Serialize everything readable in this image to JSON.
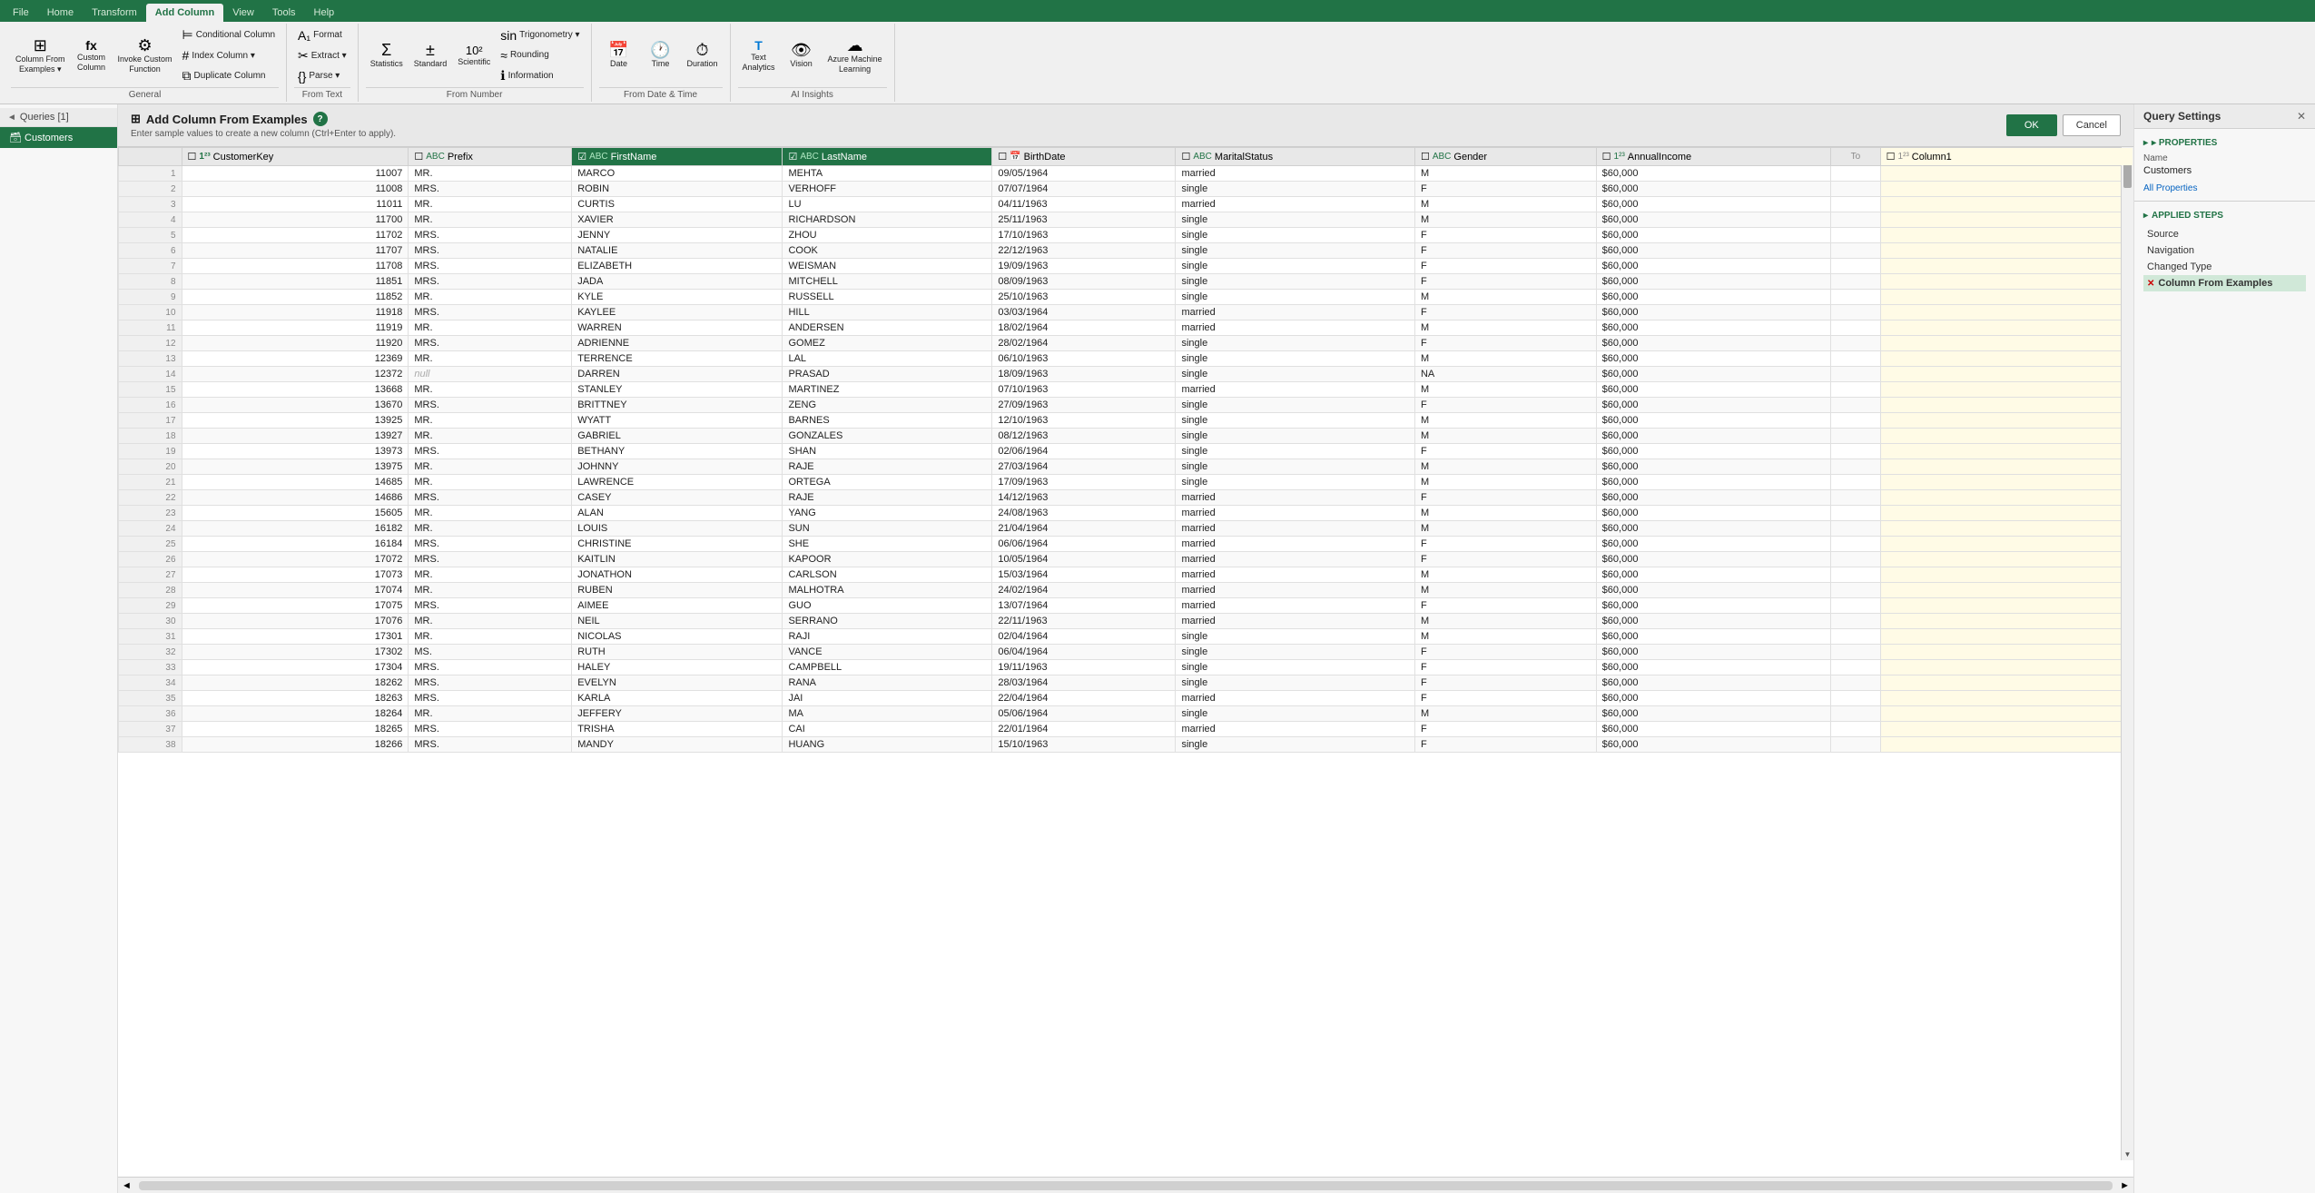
{
  "ribbon": {
    "tabs": [
      "File",
      "Home",
      "Transform",
      "Add Column",
      "View",
      "Tools",
      "Help"
    ],
    "active_tab": "Add Column",
    "groups": [
      {
        "name": "General",
        "items": [
          {
            "id": "column-from-examples",
            "icon": "⊞",
            "label": "Column From\nExamples ▾"
          },
          {
            "id": "custom-column",
            "icon": "fx",
            "label": "Custom\nColumn"
          },
          {
            "id": "invoke-custom",
            "icon": "⚙",
            "label": "Invoke Custom\nFunction"
          },
          {
            "id": "conditional-column",
            "icon": "⟦⟧",
            "label": "Conditional Column"
          },
          {
            "id": "index-column",
            "icon": "#",
            "label": "Index Column ▾"
          },
          {
            "id": "duplicate-column",
            "icon": "⧉",
            "label": "Duplicate Column"
          }
        ]
      },
      {
        "name": "From Text",
        "items": [
          {
            "id": "format",
            "icon": "A₁",
            "label": "Format"
          },
          {
            "id": "extract",
            "icon": "✂",
            "label": "Extract ▾"
          },
          {
            "id": "parse",
            "icon": "{}",
            "label": "Parse ▾"
          }
        ]
      },
      {
        "name": "From Number",
        "items": [
          {
            "id": "statistics",
            "icon": "Σ",
            "label": "Statistics"
          },
          {
            "id": "standard",
            "icon": "±",
            "label": "Standard"
          },
          {
            "id": "scientific",
            "icon": "10²",
            "label": "Scientific"
          },
          {
            "id": "trigonometry",
            "icon": "sin",
            "label": "Trigonometry ▾"
          },
          {
            "id": "rounding",
            "icon": "≈",
            "label": "Rounding"
          },
          {
            "id": "information",
            "icon": "ℹ",
            "label": "Information"
          }
        ]
      },
      {
        "name": "From Date & Time",
        "items": [
          {
            "id": "date",
            "icon": "📅",
            "label": "Date"
          },
          {
            "id": "time",
            "icon": "🕐",
            "label": "Time"
          },
          {
            "id": "duration",
            "icon": "⏱",
            "label": "Duration"
          },
          {
            "id": "text-analytics",
            "icon": "T",
            "label": "Text\nAnalytics"
          },
          {
            "id": "vision",
            "icon": "👁",
            "label": "Vision"
          },
          {
            "id": "azure-ml",
            "icon": "☁",
            "label": "Azure Machine\nLearning"
          }
        ]
      }
    ]
  },
  "sidebar": {
    "header": "Queries [1]",
    "items": [
      {
        "label": "Customers",
        "active": true
      }
    ]
  },
  "dialog": {
    "title": "Add Column From Examples",
    "subtitle": "Enter sample values to create a new column (Ctrl+Enter to apply).",
    "btn_ok": "OK",
    "btn_cancel": "Cancel"
  },
  "table": {
    "columns": [
      {
        "id": "customerkey",
        "label": "CustomerKey",
        "type": "123",
        "checked": false
      },
      {
        "id": "prefix",
        "label": "Prefix",
        "type": "ABC",
        "checked": false
      },
      {
        "id": "firstname",
        "label": "FirstName",
        "type": "ABC",
        "checked": true,
        "highlight": true
      },
      {
        "id": "lastname",
        "label": "LastName",
        "type": "ABC",
        "checked": true,
        "highlight": true
      },
      {
        "id": "birthdate",
        "label": "BirthDate",
        "type": "cal",
        "checked": false
      },
      {
        "id": "maritalstatus",
        "label": "MaritalStatus",
        "type": "ABC",
        "checked": false
      },
      {
        "id": "gender",
        "label": "Gender",
        "type": "ABC",
        "checked": false
      },
      {
        "id": "annualincome",
        "label": "AnnualIncome",
        "type": "123",
        "checked": false
      },
      {
        "id": "column1",
        "label": "Column1",
        "type": "123",
        "checked": false,
        "last": true
      }
    ],
    "rows": [
      {
        "num": 1,
        "customerkey": "11007",
        "prefix": "MR.",
        "firstname": "MARCO",
        "lastname": "MEHTA",
        "birthdate": "09/05/1964",
        "maritalstatus": "married",
        "gender": "M",
        "annualincome": "$60,000",
        "column1": ""
      },
      {
        "num": 2,
        "customerkey": "11008",
        "prefix": "MRS.",
        "firstname": "ROBIN",
        "lastname": "VERHOFF",
        "birthdate": "07/07/1964",
        "maritalstatus": "single",
        "gender": "F",
        "annualincome": "$60,000",
        "column1": ""
      },
      {
        "num": 3,
        "customerkey": "11011",
        "prefix": "MR.",
        "firstname": "CURTIS",
        "lastname": "LU",
        "birthdate": "04/11/1963",
        "maritalstatus": "married",
        "gender": "M",
        "annualincome": "$60,000",
        "column1": ""
      },
      {
        "num": 4,
        "customerkey": "11700",
        "prefix": "MR.",
        "firstname": "XAVIER",
        "lastname": "RICHARDSON",
        "birthdate": "25/11/1963",
        "maritalstatus": "single",
        "gender": "M",
        "annualincome": "$60,000",
        "column1": ""
      },
      {
        "num": 5,
        "customerkey": "11702",
        "prefix": "MRS.",
        "firstname": "JENNY",
        "lastname": "ZHOU",
        "birthdate": "17/10/1963",
        "maritalstatus": "single",
        "gender": "F",
        "annualincome": "$60,000",
        "column1": ""
      },
      {
        "num": 6,
        "customerkey": "11707",
        "prefix": "MRS.",
        "firstname": "NATALIE",
        "lastname": "COOK",
        "birthdate": "22/12/1963",
        "maritalstatus": "single",
        "gender": "F",
        "annualincome": "$60,000",
        "column1": ""
      },
      {
        "num": 7,
        "customerkey": "11708",
        "prefix": "MRS.",
        "firstname": "ELIZABETH",
        "lastname": "WEISMAN",
        "birthdate": "19/09/1963",
        "maritalstatus": "single",
        "gender": "F",
        "annualincome": "$60,000",
        "column1": ""
      },
      {
        "num": 8,
        "customerkey": "11851",
        "prefix": "MRS.",
        "firstname": "JADA",
        "lastname": "MITCHELL",
        "birthdate": "08/09/1963",
        "maritalstatus": "single",
        "gender": "F",
        "annualincome": "$60,000",
        "column1": ""
      },
      {
        "num": 9,
        "customerkey": "11852",
        "prefix": "MR.",
        "firstname": "KYLE",
        "lastname": "RUSSELL",
        "birthdate": "25/10/1963",
        "maritalstatus": "single",
        "gender": "M",
        "annualincome": "$60,000",
        "column1": ""
      },
      {
        "num": 10,
        "customerkey": "11918",
        "prefix": "MRS.",
        "firstname": "KAYLEE",
        "lastname": "HILL",
        "birthdate": "03/03/1964",
        "maritalstatus": "married",
        "gender": "F",
        "annualincome": "$60,000",
        "column1": ""
      },
      {
        "num": 11,
        "customerkey": "11919",
        "prefix": "MR.",
        "firstname": "WARREN",
        "lastname": "ANDERSEN",
        "birthdate": "18/02/1964",
        "maritalstatus": "married",
        "gender": "M",
        "annualincome": "$60,000",
        "column1": ""
      },
      {
        "num": 12,
        "customerkey": "11920",
        "prefix": "MRS.",
        "firstname": "ADRIENNE",
        "lastname": "GOMEZ",
        "birthdate": "28/02/1964",
        "maritalstatus": "single",
        "gender": "F",
        "annualincome": "$60,000",
        "column1": ""
      },
      {
        "num": 13,
        "customerkey": "12369",
        "prefix": "MR.",
        "firstname": "TERRENCE",
        "lastname": "LAL",
        "birthdate": "06/10/1963",
        "maritalstatus": "single",
        "gender": "M",
        "annualincome": "$60,000",
        "column1": ""
      },
      {
        "num": 14,
        "customerkey": "12372",
        "prefix": "null",
        "firstname": "DARREN",
        "lastname": "PRASAD",
        "birthdate": "18/09/1963",
        "maritalstatus": "single",
        "gender": "NA",
        "annualincome": "$60,000",
        "column1": ""
      },
      {
        "num": 15,
        "customerkey": "13668",
        "prefix": "MR.",
        "firstname": "STANLEY",
        "lastname": "MARTINEZ",
        "birthdate": "07/10/1963",
        "maritalstatus": "married",
        "gender": "M",
        "annualincome": "$60,000",
        "column1": ""
      },
      {
        "num": 16,
        "customerkey": "13670",
        "prefix": "MRS.",
        "firstname": "BRITTNEY",
        "lastname": "ZENG",
        "birthdate": "27/09/1963",
        "maritalstatus": "single",
        "gender": "F",
        "annualincome": "$60,000",
        "column1": ""
      },
      {
        "num": 17,
        "customerkey": "13925",
        "prefix": "MR.",
        "firstname": "WYATT",
        "lastname": "BARNES",
        "birthdate": "12/10/1963",
        "maritalstatus": "single",
        "gender": "M",
        "annualincome": "$60,000",
        "column1": ""
      },
      {
        "num": 18,
        "customerkey": "13927",
        "prefix": "MR.",
        "firstname": "GABRIEL",
        "lastname": "GONZALES",
        "birthdate": "08/12/1963",
        "maritalstatus": "single",
        "gender": "M",
        "annualincome": "$60,000",
        "column1": ""
      },
      {
        "num": 19,
        "customerkey": "13973",
        "prefix": "MRS.",
        "firstname": "BETHANY",
        "lastname": "SHAN",
        "birthdate": "02/06/1964",
        "maritalstatus": "single",
        "gender": "F",
        "annualincome": "$60,000",
        "column1": ""
      },
      {
        "num": 20,
        "customerkey": "13975",
        "prefix": "MR.",
        "firstname": "JOHNNY",
        "lastname": "RAJE",
        "birthdate": "27/03/1964",
        "maritalstatus": "single",
        "gender": "M",
        "annualincome": "$60,000",
        "column1": ""
      },
      {
        "num": 21,
        "customerkey": "14685",
        "prefix": "MR.",
        "firstname": "LAWRENCE",
        "lastname": "ORTEGA",
        "birthdate": "17/09/1963",
        "maritalstatus": "single",
        "gender": "M",
        "annualincome": "$60,000",
        "column1": ""
      },
      {
        "num": 22,
        "customerkey": "14686",
        "prefix": "MRS.",
        "firstname": "CASEY",
        "lastname": "RAJE",
        "birthdate": "14/12/1963",
        "maritalstatus": "married",
        "gender": "F",
        "annualincome": "$60,000",
        "column1": ""
      },
      {
        "num": 23,
        "customerkey": "15605",
        "prefix": "MR.",
        "firstname": "ALAN",
        "lastname": "YANG",
        "birthdate": "24/08/1963",
        "maritalstatus": "married",
        "gender": "M",
        "annualincome": "$60,000",
        "column1": ""
      },
      {
        "num": 24,
        "customerkey": "16182",
        "prefix": "MR.",
        "firstname": "LOUIS",
        "lastname": "SUN",
        "birthdate": "21/04/1964",
        "maritalstatus": "married",
        "gender": "M",
        "annualincome": "$60,000",
        "column1": ""
      },
      {
        "num": 25,
        "customerkey": "16184",
        "prefix": "MRS.",
        "firstname": "CHRISTINE",
        "lastname": "SHE",
        "birthdate": "06/06/1964",
        "maritalstatus": "married",
        "gender": "F",
        "annualincome": "$60,000",
        "column1": ""
      },
      {
        "num": 26,
        "customerkey": "17072",
        "prefix": "MRS.",
        "firstname": "KAITLIN",
        "lastname": "KAPOOR",
        "birthdate": "10/05/1964",
        "maritalstatus": "married",
        "gender": "F",
        "annualincome": "$60,000",
        "column1": ""
      },
      {
        "num": 27,
        "customerkey": "17073",
        "prefix": "MR.",
        "firstname": "JONATHON",
        "lastname": "CARLSON",
        "birthdate": "15/03/1964",
        "maritalstatus": "married",
        "gender": "M",
        "annualincome": "$60,000",
        "column1": ""
      },
      {
        "num": 28,
        "customerkey": "17074",
        "prefix": "MR.",
        "firstname": "RUBEN",
        "lastname": "MALHOTRA",
        "birthdate": "24/02/1964",
        "maritalstatus": "married",
        "gender": "M",
        "annualincome": "$60,000",
        "column1": ""
      },
      {
        "num": 29,
        "customerkey": "17075",
        "prefix": "MRS.",
        "firstname": "AIMEE",
        "lastname": "GUO",
        "birthdate": "13/07/1964",
        "maritalstatus": "married",
        "gender": "F",
        "annualincome": "$60,000",
        "column1": ""
      },
      {
        "num": 30,
        "customerkey": "17076",
        "prefix": "MR.",
        "firstname": "NEIL",
        "lastname": "SERRANO",
        "birthdate": "22/11/1963",
        "maritalstatus": "married",
        "gender": "M",
        "annualincome": "$60,000",
        "column1": ""
      },
      {
        "num": 31,
        "customerkey": "17301",
        "prefix": "MR.",
        "firstname": "NICOLAS",
        "lastname": "RAJI",
        "birthdate": "02/04/1964",
        "maritalstatus": "single",
        "gender": "M",
        "annualincome": "$60,000",
        "column1": ""
      },
      {
        "num": 32,
        "customerkey": "17302",
        "prefix": "MS.",
        "firstname": "RUTH",
        "lastname": "VANCE",
        "birthdate": "06/04/1964",
        "maritalstatus": "single",
        "gender": "F",
        "annualincome": "$60,000",
        "column1": ""
      },
      {
        "num": 33,
        "customerkey": "17304",
        "prefix": "MRS.",
        "firstname": "HALEY",
        "lastname": "CAMPBELL",
        "birthdate": "19/11/1963",
        "maritalstatus": "single",
        "gender": "F",
        "annualincome": "$60,000",
        "column1": ""
      },
      {
        "num": 34,
        "customerkey": "18262",
        "prefix": "MRS.",
        "firstname": "EVELYN",
        "lastname": "RANA",
        "birthdate": "28/03/1964",
        "maritalstatus": "single",
        "gender": "F",
        "annualincome": "$60,000",
        "column1": ""
      },
      {
        "num": 35,
        "customerkey": "18263",
        "prefix": "MRS.",
        "firstname": "KARLA",
        "lastname": "JAI",
        "birthdate": "22/04/1964",
        "maritalstatus": "married",
        "gender": "F",
        "annualincome": "$60,000",
        "column1": ""
      },
      {
        "num": 36,
        "customerkey": "18264",
        "prefix": "MR.",
        "firstname": "JEFFERY",
        "lastname": "MA",
        "birthdate": "05/06/1964",
        "maritalstatus": "single",
        "gender": "M",
        "annualincome": "$60,000",
        "column1": ""
      },
      {
        "num": 37,
        "customerkey": "18265",
        "prefix": "MRS.",
        "firstname": "TRISHA",
        "lastname": "CAI",
        "birthdate": "22/01/1964",
        "maritalstatus": "married",
        "gender": "F",
        "annualincome": "$60,000",
        "column1": ""
      },
      {
        "num": 38,
        "customerkey": "18266",
        "prefix": "MRS.",
        "firstname": "MANDY",
        "lastname": "HUANG",
        "birthdate": "15/10/1963",
        "maritalstatus": "single",
        "gender": "F",
        "annualincome": "$60,000",
        "column1": ""
      }
    ]
  },
  "right_panel": {
    "title": "Query Settings",
    "properties_title": "▸ PROPERTIES",
    "name_label": "Name",
    "name_value": "Customers",
    "all_properties_link": "All Properties",
    "applied_steps_title": "▸ APPLIED STEPS",
    "steps": [
      {
        "label": "Source",
        "removable": false
      },
      {
        "label": "Navigation",
        "removable": false
      },
      {
        "label": "Changed Type",
        "removable": false
      },
      {
        "label": "Column From Examples",
        "removable": true,
        "active": true
      }
    ]
  },
  "colors": {
    "green": "#217346",
    "light_green": "#d0e8d8",
    "highlight_col": "#217346",
    "last_col": "#fffbe6"
  }
}
